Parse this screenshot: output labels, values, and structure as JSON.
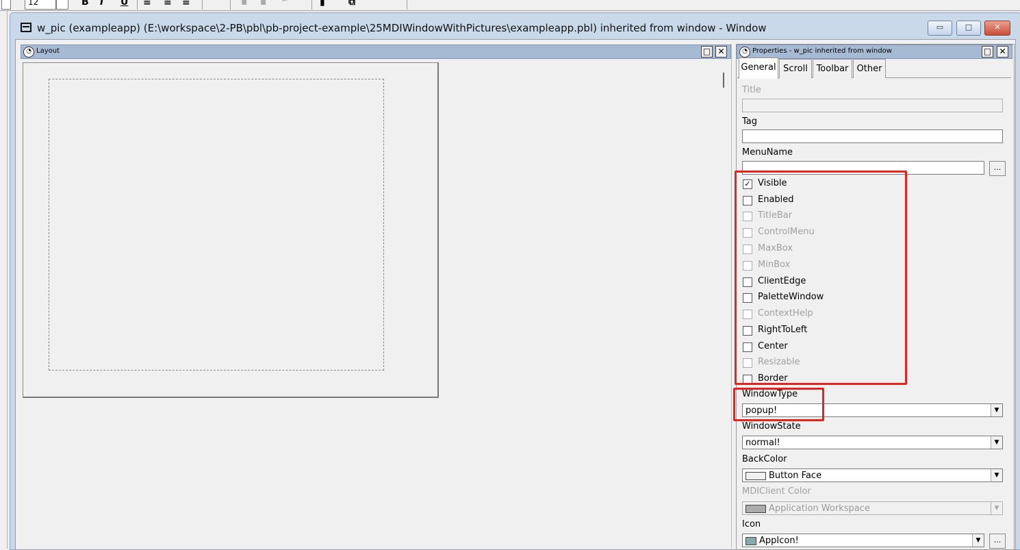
{
  "toolbar": {
    "font_size": "12",
    "bold": "B",
    "italic": "I",
    "underline": "U"
  },
  "window": {
    "title": "w_pic (exampleapp) (E:\\workspace\\2-PB\\pbl\\pb-project-example\\25MDIWindowWithPictures\\exampleapp.pbl) inherited from window - Window",
    "min": "▭",
    "max": "□",
    "close": "✕"
  },
  "layout_pane": {
    "title": "Layout",
    "restore": "□",
    "close": "✕"
  },
  "props_pane": {
    "title": "Properties - w_pic inherited from window",
    "restore": "□",
    "close": "✕",
    "tabs": [
      "General",
      "Scroll",
      "Toolbar",
      "Other"
    ],
    "fields": {
      "title_label": "Title",
      "title_value": "",
      "tag_label": "Tag",
      "tag_value": "",
      "menuname_label": "MenuName",
      "menuname_value": "",
      "ellipsis": "...",
      "windowtype_label": "WindowType",
      "windowtype_value": "popup!",
      "windowstate_label": "WindowState",
      "windowstate_value": "normal!",
      "backcolor_label": "BackColor",
      "backcolor_value": "Button Face",
      "mdiclient_label": "MDIClient Color",
      "mdiclient_value": "Application Workspace",
      "icon_label": "Icon",
      "icon_value": "AppIcon!"
    },
    "checkboxes": [
      {
        "label": "Visible",
        "checked": true,
        "disabled": false
      },
      {
        "label": "Enabled",
        "checked": false,
        "disabled": false
      },
      {
        "label": "TitleBar",
        "checked": false,
        "disabled": true
      },
      {
        "label": "ControlMenu",
        "checked": false,
        "disabled": true
      },
      {
        "label": "MaxBox",
        "checked": false,
        "disabled": true
      },
      {
        "label": "MinBox",
        "checked": false,
        "disabled": true
      },
      {
        "label": "ClientEdge",
        "checked": false,
        "disabled": false
      },
      {
        "label": "PaletteWindow",
        "checked": false,
        "disabled": false
      },
      {
        "label": "ContextHelp",
        "checked": false,
        "disabled": true
      },
      {
        "label": "RightToLeft",
        "checked": false,
        "disabled": false
      },
      {
        "label": "Center",
        "checked": false,
        "disabled": false
      },
      {
        "label": "Resizable",
        "checked": false,
        "disabled": true
      },
      {
        "label": "Border",
        "checked": false,
        "disabled": false
      }
    ]
  },
  "colors": {
    "highlight": "#e8231c",
    "button_face": "#f0f0f0",
    "app_workspace": "#abababa"
  },
  "icons": {
    "checkmark": "✓",
    "dropdown": "▼"
  }
}
